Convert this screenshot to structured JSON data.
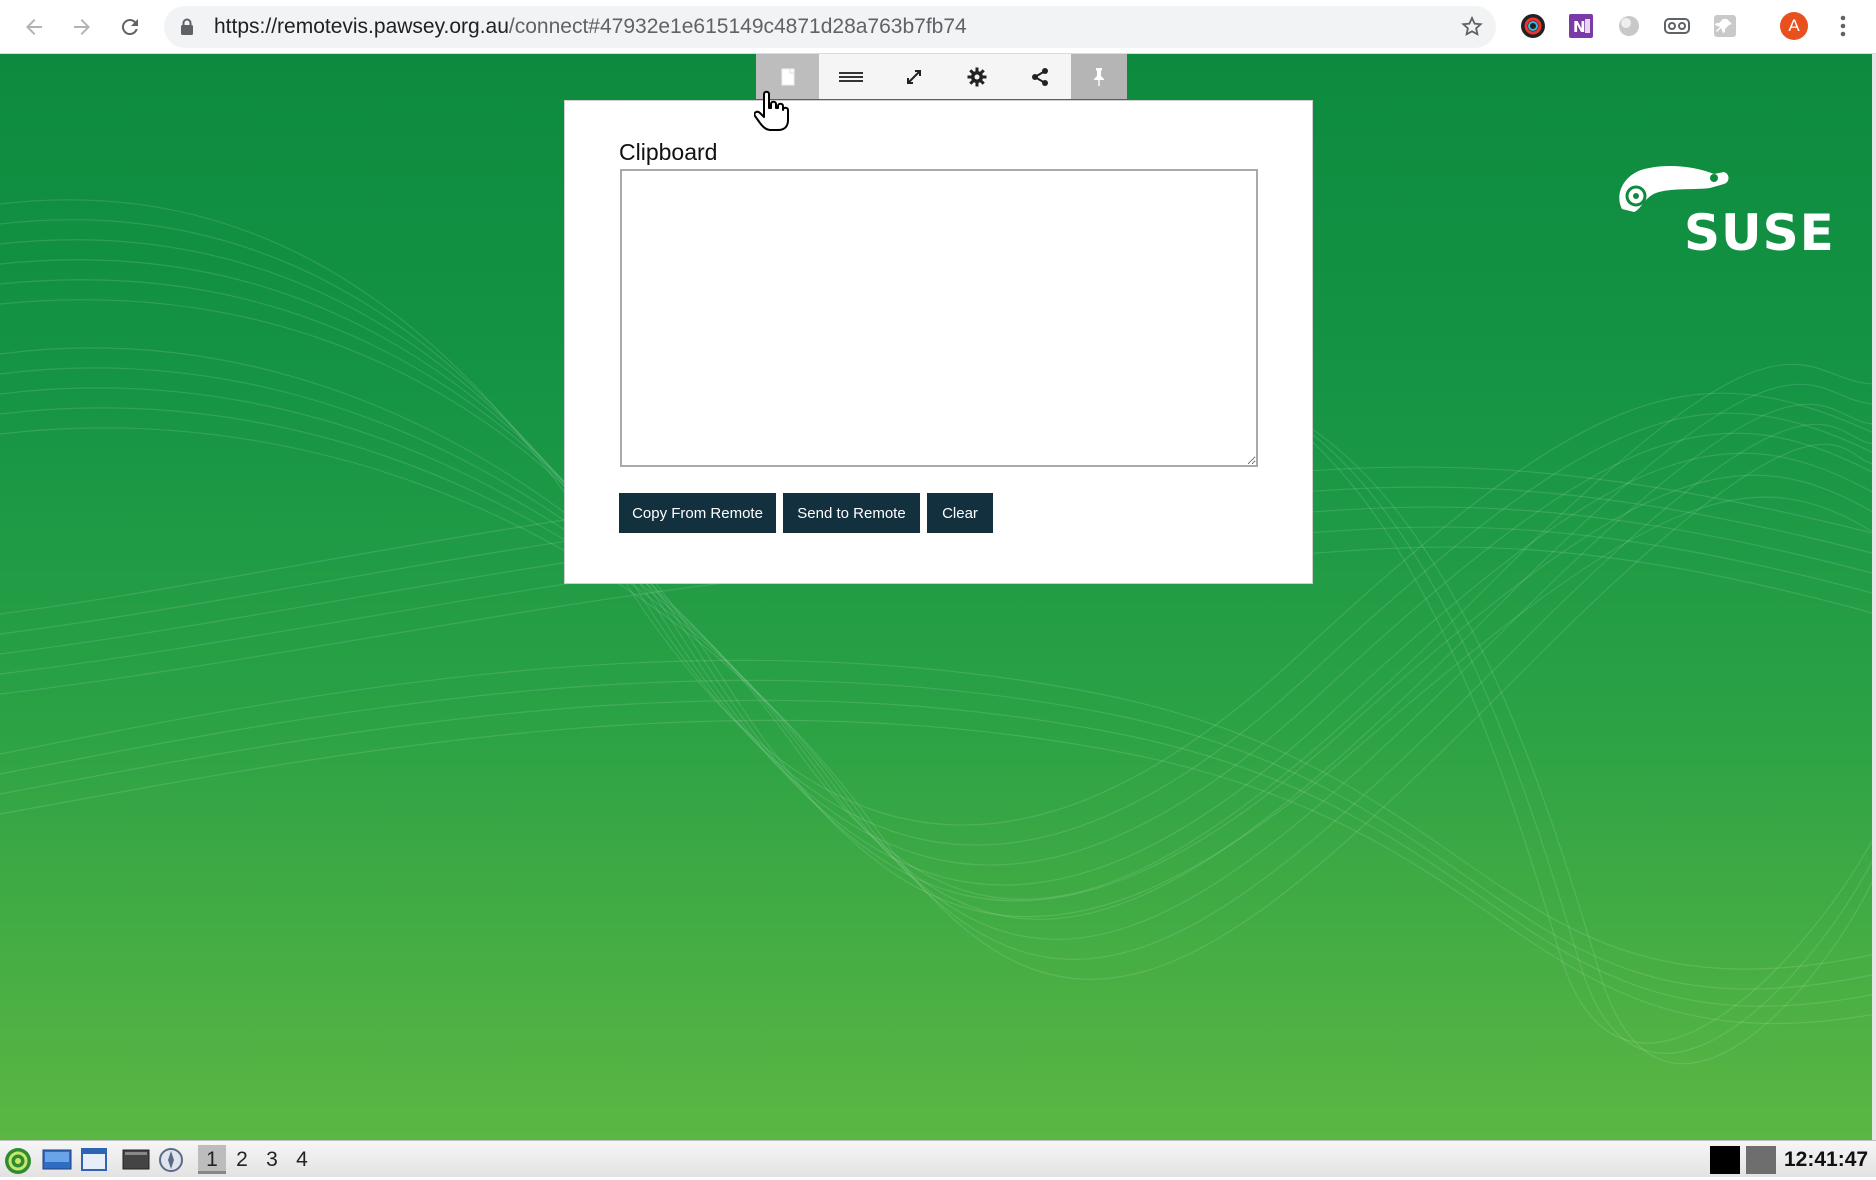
{
  "browser": {
    "url_host": "https://remotevis.pawsey.org.au",
    "url_rest": "/connect#47932e1e615149c4871d28a763b7fb74",
    "profile_initial": "A",
    "profile_color": "#e8501e"
  },
  "desktop": {
    "logo_text": "SUSE",
    "accent": "#0d8a3e"
  },
  "control_bar": {
    "items": [
      "clipboard-icon",
      "menu-icon",
      "fullscreen-icon",
      "gear-icon",
      "share-icon",
      "pin-icon"
    ],
    "active": "clipboard-icon"
  },
  "clipboard": {
    "title": "Clipboard",
    "text_value": "",
    "copy_label": "Copy From Remote",
    "send_label": "Send to Remote",
    "clear_label": "Clear",
    "button_color": "#13303f"
  },
  "taskbar": {
    "workspaces": [
      "1",
      "2",
      "3",
      "4"
    ],
    "active_workspace": "1",
    "clock": "12:41:47"
  }
}
